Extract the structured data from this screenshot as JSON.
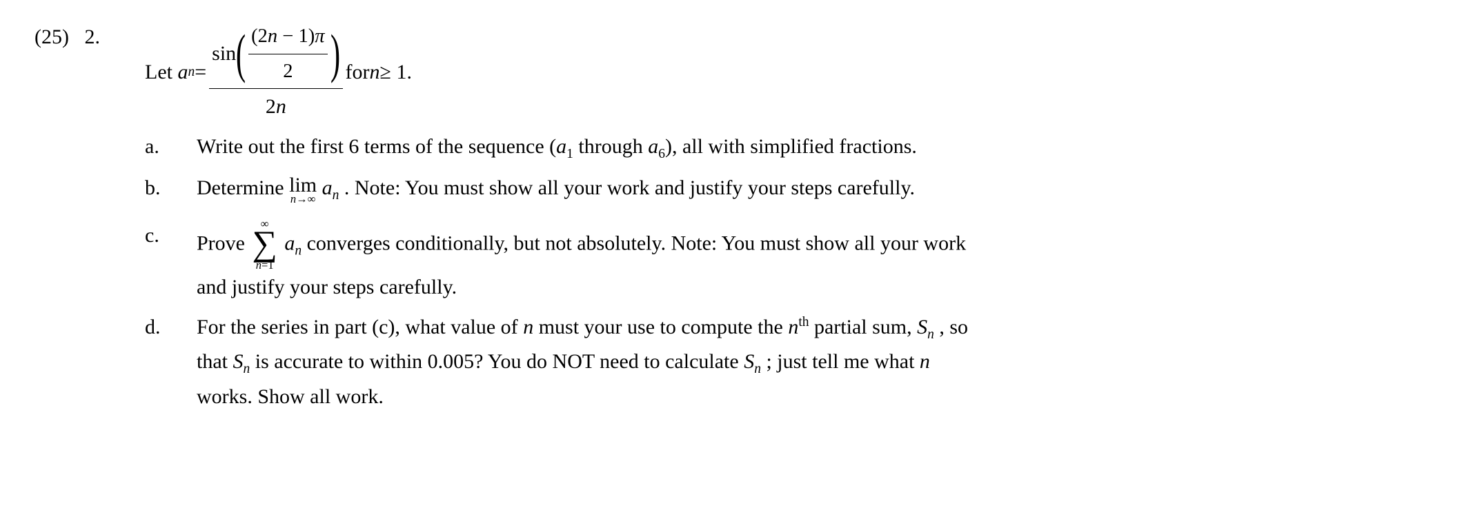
{
  "problem": {
    "points": "(25)",
    "number": "2.",
    "let": "Let",
    "an": "a",
    "sub_n": "n",
    "equals": " = ",
    "sin": "sin",
    "inner_num_open": "(",
    "inner_num_expr1": "2",
    "inner_num_expr_n": "n",
    "inner_num_minus": " − 1",
    "inner_num_close": ")",
    "pi": "π",
    "inner_den": "2",
    "outer_den_2": "2",
    "outer_den_n": "n",
    "for": " for ",
    "nvar": "n",
    "geq1": " ≥ 1.",
    "parts": {
      "a": {
        "label": "a.",
        "text1": "Write out the first 6 terms of the sequence (",
        "a1_a": "a",
        "a1_sub": "1",
        "through": " through ",
        "a6_a": "a",
        "a6_sub": "6",
        "text2": "), all with simplified fractions."
      },
      "b": {
        "label": "b.",
        "text1": "Determine ",
        "lim": "lim",
        "lim_sub_n": "n",
        "lim_sub_arrow": "→∞",
        "a": "a",
        "sub_n": "n",
        "text2": " . Note: You must show all your work and justify your steps carefully."
      },
      "c": {
        "label": "c.",
        "text1": "Prove ",
        "sum_top": "∞",
        "sum_sigma": "∑",
        "sum_bot_n": "n",
        "sum_bot_eq1": "=1",
        "a": "a",
        "sub_n": "n",
        "text2": " converges conditionally, but not absolutely. Note: You must show all your work",
        "text3": "and justify your steps carefully."
      },
      "d": {
        "label": "d.",
        "text1": "For the series in part (c), what value of ",
        "n1": "n",
        "text2": " must your use to compute the ",
        "n2": "n",
        "th": "th",
        "text3": " partial sum, ",
        "S1": "S",
        "S1_sub": "n",
        "text4": " , so",
        "text5": "that ",
        "S2": "S",
        "S2_sub": "n",
        "text6": " is accurate to within 0.005? You do NOT need to calculate ",
        "S3": "S",
        "S3_sub": "n",
        "text7": " ; just tell me what ",
        "n3": "n",
        "text8": "works. Show all work."
      }
    }
  }
}
